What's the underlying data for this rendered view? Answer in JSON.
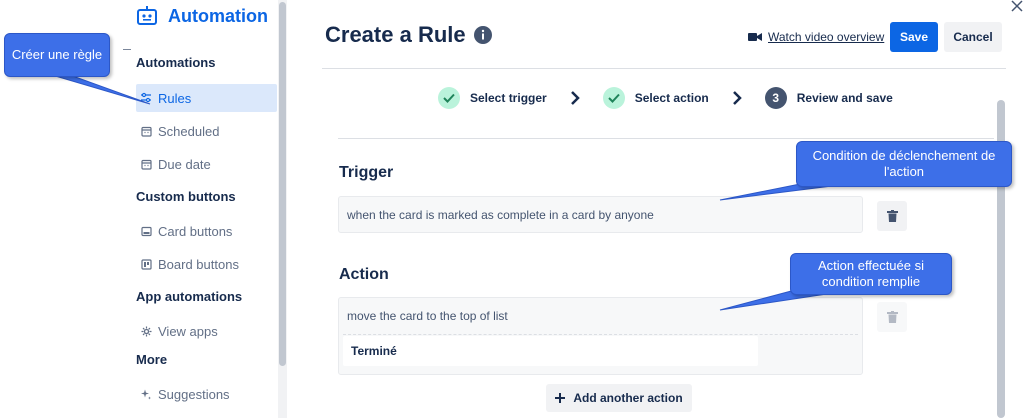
{
  "colors": {
    "accent": "#0c66e4",
    "callout": "#3d6fe8",
    "step_done": "#baf3db",
    "step_current": "#44546f"
  },
  "sidebar": {
    "title": "Automation",
    "icon": "robot-icon",
    "sections": [
      {
        "label": "Automations"
      },
      {
        "label": "Custom buttons"
      },
      {
        "label": "App automations"
      },
      {
        "label": "More"
      }
    ],
    "items": [
      {
        "label": "Rules",
        "icon": "sliders-icon",
        "active": true
      },
      {
        "label": "Scheduled",
        "icon": "calendar-icon"
      },
      {
        "label": "Due date",
        "icon": "calendar-icon"
      },
      {
        "label": "Card buttons",
        "icon": "card-icon"
      },
      {
        "label": "Board buttons",
        "icon": "board-icon"
      },
      {
        "label": "View apps",
        "icon": "gear-icon"
      },
      {
        "label": "Suggestions",
        "icon": "sparkle-icon"
      }
    ]
  },
  "header": {
    "title": "Create a Rule",
    "watch_label": "Watch video overview",
    "save_label": "Save",
    "cancel_label": "Cancel"
  },
  "steps": [
    {
      "label": "Select trigger",
      "state": "done"
    },
    {
      "label": "Select action",
      "state": "done"
    },
    {
      "label": "Review and save",
      "state": "current",
      "number": "3"
    }
  ],
  "trigger": {
    "title": "Trigger",
    "text": "when the card is marked as complete in a card by anyone"
  },
  "action": {
    "title": "Action",
    "text": "move the card to the top of list",
    "list_value": "Terminé",
    "add_label": "Add another action"
  },
  "callouts": {
    "create_rule": "Créer une règle",
    "trigger_condition": "Condition de déclenchement de l'action",
    "action_performed": "Action effectuée si condition remplie"
  }
}
